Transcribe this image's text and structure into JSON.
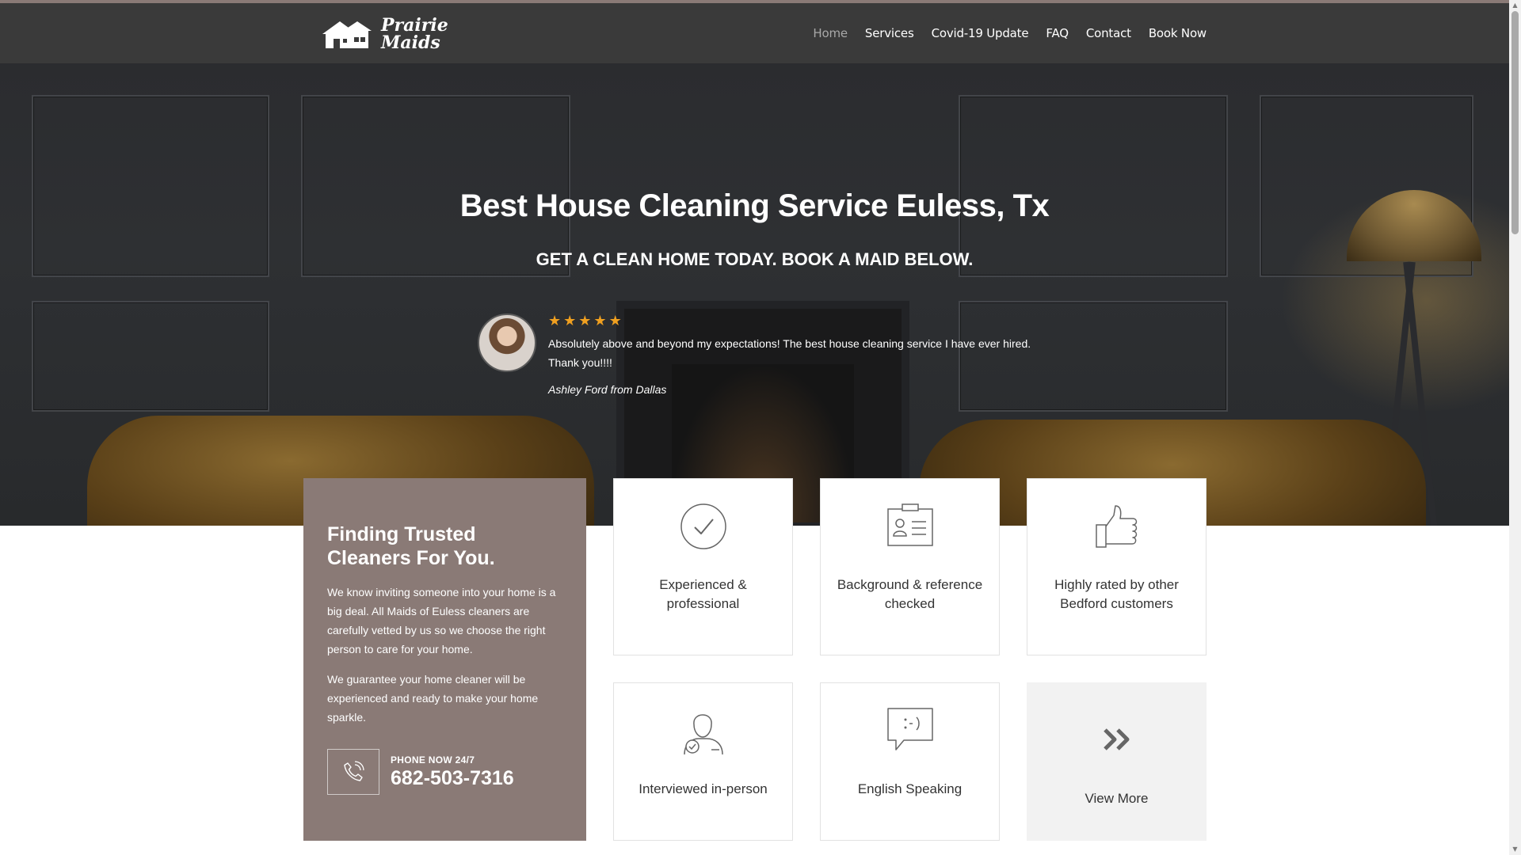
{
  "brand": {
    "logo_line1": "Prairie",
    "logo_line2": "Maids"
  },
  "nav": {
    "items": [
      {
        "label": "Home",
        "active": true
      },
      {
        "label": "Services"
      },
      {
        "label": "Covid-19 Update"
      },
      {
        "label": "FAQ"
      },
      {
        "label": "Contact"
      },
      {
        "label": "Book Now"
      }
    ]
  },
  "hero": {
    "title": "Best House Cleaning Service Euless, Tx",
    "subtitle": "GET A CLEAN HOME TODAY. BOOK A MAID BELOW."
  },
  "testimonial": {
    "rating": 5,
    "quote": "Absolutely above and beyond my expectations! The best house cleaning service I have ever hired. Thank you!!!!",
    "author": "Ashley Ford from Dallas"
  },
  "info": {
    "title": "Finding Trusted Cleaners For You.",
    "paragraph1": "We know inviting someone into your home is a big deal. All Maids of Euless cleaners are carefully vetted by us so we choose the right person to care for your home.",
    "paragraph2": "We guarantee your home cleaner will be experienced and ready to make your home sparkle.",
    "phone_label": "PHONE NOW 24/7",
    "phone_number": "682-503-7316"
  },
  "features": [
    {
      "label": "Experienced & professional",
      "icon": "check-circle-icon"
    },
    {
      "label": "Background & reference checked",
      "icon": "id-card-icon"
    },
    {
      "label": "Highly rated by other Bedford customers",
      "icon": "thumbs-up-icon"
    },
    {
      "label": "Interviewed in-person",
      "icon": "person-check-icon"
    },
    {
      "label": "English Speaking",
      "icon": "speech-bubble-icon"
    },
    {
      "label": "View More",
      "icon": "double-chevron-right-icon"
    }
  ],
  "colors": {
    "navbar": "#3a3a3a",
    "card_accent": "#8a7a76",
    "star": "#f0a020",
    "nav_active": "#a8a8a8"
  }
}
